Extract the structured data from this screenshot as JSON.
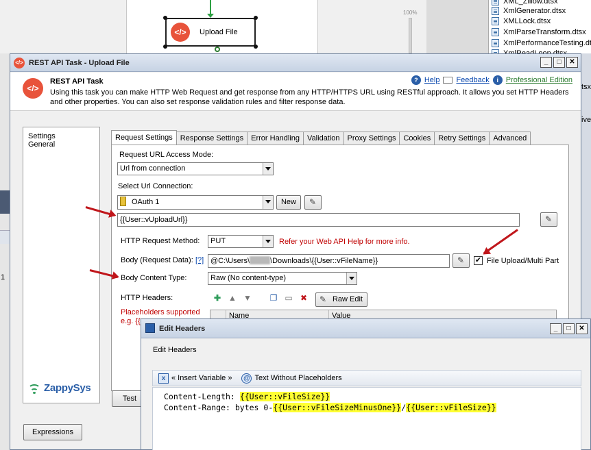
{
  "background": {
    "designer_task_label": "Upload File",
    "zoom_label": "100%",
    "explorer_files": [
      "XML_Zillow.dtsx",
      "XmlGenerator.dtsx",
      "XMLLock.dtsx",
      "XmlParseTransform.dtsx",
      "XmlPerformanceTesting.dtsx",
      "XmlReadLoop.dtsx"
    ],
    "right_edge_text": [
      "tsx",
      "ive"
    ],
    "left_edge_char": "1"
  },
  "dialog": {
    "title": "REST API Task - Upload File",
    "header_title": "REST API Task",
    "header_desc": "Using this task you can make HTTP Web Request and get response from any HTTP/HTTPS URL using RESTful approach. It allows you set HTTP Headers and other properties. You can also set response validation rules and filter response data.",
    "links": {
      "help": "Help",
      "feedback": "Feedback",
      "edition": "Professional Edition"
    },
    "left_items": [
      "Settings",
      "General"
    ],
    "logo_text": "ZappySys",
    "tabs": [
      "Request Settings",
      "Response Settings",
      "Error Handling",
      "Validation",
      "Proxy Settings",
      "Cookies",
      "Retry Settings",
      "Advanced"
    ],
    "url_access_mode_label": "Request URL Access Mode:",
    "url_access_mode_value": "Url from connection",
    "select_url_conn_label": "Select Url Connection:",
    "url_conn_value": "OAuth 1",
    "new_button": "New",
    "url_value": "{{User::vUploadUrl}}",
    "method_label": "HTTP Request Method:",
    "method_value": "PUT",
    "method_hint": "Refer your Web API Help for more info.",
    "body_label": "Body (Request Data):",
    "body_help": "[?]",
    "body_value_prefix": "@C:\\Users\\",
    "body_value_suffix": "\\Downloads\\{{User::vFileName}}",
    "file_upload_label": "File Upload/Multi Part",
    "file_upload_checked": "✔",
    "content_type_label": "Body Content Type:",
    "content_type_value": "Raw (No content-type)",
    "headers_label": "HTTP Headers:",
    "placeholders_line1": "Placeholders supported",
    "placeholders_line2": "e.g. {{",
    "raw_edit": "Raw Edit",
    "grid_cols": [
      "Name",
      "Value"
    ],
    "test_button": "Test",
    "expressions_button": "Expressions"
  },
  "edit_headers": {
    "title": "Edit Headers",
    "subtitle": "Edit Headers",
    "insert_variable": "« Insert Variable »",
    "text_without_placeholders": "Text Without Placeholders",
    "line1_key": "Content-Length: ",
    "line1_val": "{{User::vFileSize}}",
    "line2_key": "Content-Range: bytes 0-",
    "line2_val1": "{{User::vFileSizeMinusOne}}",
    "line2_sep": "/",
    "line2_val2": "{{User::vFileSize}}"
  },
  "colors": {
    "accent_red": "#c0161b",
    "highlight": "#ffff33",
    "zappysys_blue": "#2b5fa8",
    "brand_orange": "#e8533b"
  }
}
